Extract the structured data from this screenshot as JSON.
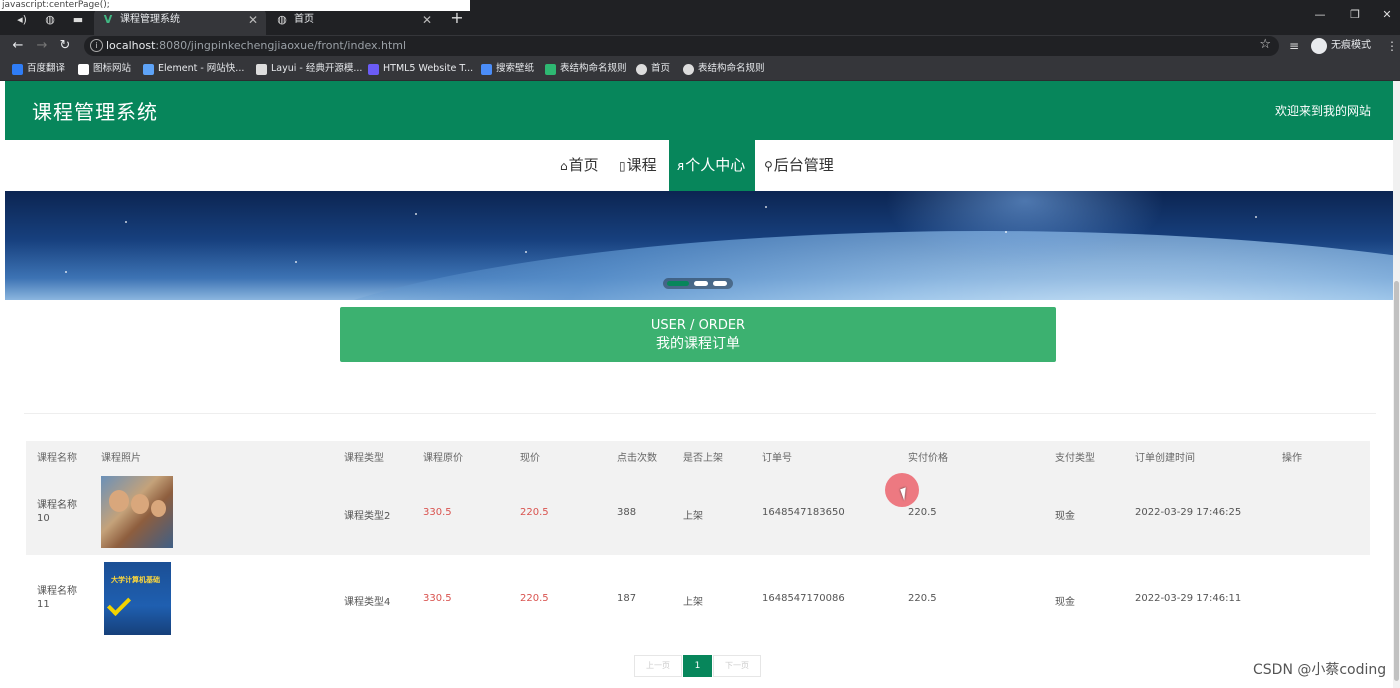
{
  "browser": {
    "status_tip": "javascript:centerPage();",
    "tabs": [
      {
        "title": "课程管理系统",
        "icon": "vue-icon",
        "active": true
      },
      {
        "title": "首页",
        "icon": "globe-icon",
        "active": false
      }
    ],
    "address": {
      "host": "localhost",
      "rest": ":8080/jingpinkechengjiaoxue/front/index.html"
    },
    "incognito_label": "无痕模式",
    "bookmarks": [
      {
        "label": "百度翻译",
        "color": "#2f7df6"
      },
      {
        "label": "图标网站",
        "color": "#ffffff"
      },
      {
        "label": "Element - 网站快...",
        "color": "#5ea3f7"
      },
      {
        "label": "Layui - 经典开源模...",
        "color": "#dddddd"
      },
      {
        "label": "HTML5 Website T...",
        "color": "#6b5cf6"
      },
      {
        "label": "搜索壁纸",
        "color": "#4b8df8"
      },
      {
        "label": "表结构命名规则",
        "color": "#2eb872"
      },
      {
        "label": "首页",
        "color": "#dddddd"
      },
      {
        "label": "表结构命名规则",
        "color": "#dddddd"
      }
    ]
  },
  "site": {
    "title": "课程管理系统",
    "welcome": "欢迎来到我的网站",
    "brand_color": "#07865b",
    "menu": [
      {
        "label": "首页",
        "icon": "home-icon",
        "glyph": "⌂",
        "active": false
      },
      {
        "label": "课程",
        "icon": "document-icon",
        "glyph": "▯",
        "active": false
      },
      {
        "label": "个人中心",
        "icon": "user-icon",
        "glyph": "ᴙ",
        "active": true
      },
      {
        "label": "后台管理",
        "icon": "link-icon",
        "glyph": "⚲",
        "active": false
      }
    ]
  },
  "order_banner": {
    "title_en": "USER / ORDER",
    "title_cn": "我的课程订单"
  },
  "table": {
    "headers": [
      "课程名称",
      "课程照片",
      "课程类型",
      "课程原价",
      "现价",
      "点击次数",
      "是否上架",
      "订单号",
      "实付价格",
      "支付类型",
      "订单创建时间",
      "操作"
    ],
    "rows": [
      {
        "name": "课程名称10",
        "type": "课程类型2",
        "price": "330.5",
        "current": "220.5",
        "clicks": "388",
        "listed": "上架",
        "order_no": "1648547183650",
        "paid": "220.5",
        "pay_type": "现金",
        "created": "2022-03-29 17:46:25"
      },
      {
        "name": "课程名称11",
        "type": "课程类型4",
        "price": "330.5",
        "current": "220.5",
        "clicks": "187",
        "listed": "上架",
        "order_no": "1648547170086",
        "paid": "220.5",
        "pay_type": "现金",
        "created": "2022-03-29 17:46:11"
      }
    ],
    "row2_cover_text": "大学计算机基础"
  },
  "pagination": {
    "prev": "上一页",
    "current": "1",
    "next": "下一页"
  },
  "watermark": "CSDN @小蔡coding"
}
